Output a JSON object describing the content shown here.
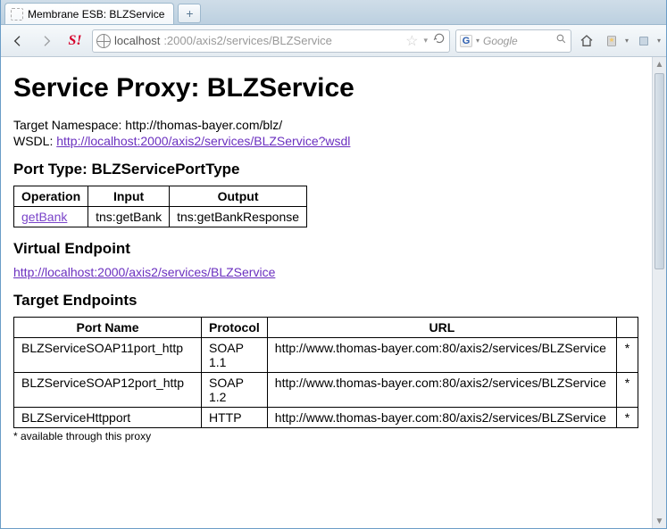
{
  "browser": {
    "tab_title": "Membrane ESB: BLZService",
    "newtab_glyph": "+",
    "url_host": "localhost",
    "url_rest": ":2000/axis2/services/BLZService",
    "search_placeholder": "Google"
  },
  "page": {
    "heading": "Service Proxy: BLZService",
    "ns_label": "Target Namespace: ",
    "ns_value": "http://thomas-bayer.com/blz/",
    "wsdl_label": "WSDL: ",
    "wsdl_link": "http://localhost:2000/axis2/services/BLZService?wsdl",
    "porttype_heading": "Port Type: BLZServicePortType",
    "ops_headers": {
      "op": "Operation",
      "in": "Input",
      "out": "Output"
    },
    "ops": [
      {
        "name": "getBank",
        "input": "tns:getBank",
        "output": "tns:getBankResponse"
      }
    ],
    "virtual_heading": "Virtual Endpoint",
    "virtual_link": "http://localhost:2000/axis2/services/BLZService",
    "targets_heading": "Target Endpoints",
    "tgt_headers": {
      "port": "Port Name",
      "proto": "Protocol",
      "url": "URL"
    },
    "targets": [
      {
        "port": "BLZServiceSOAP11port_http",
        "proto": "SOAP 1.1",
        "url": "http://www.thomas-bayer.com:80/axis2/services/BLZService",
        "mark": "*"
      },
      {
        "port": "BLZServiceSOAP12port_http",
        "proto": "SOAP 1.2",
        "url": "http://www.thomas-bayer.com:80/axis2/services/BLZService",
        "mark": "*"
      },
      {
        "port": "BLZServiceHttpport",
        "proto": "HTTP",
        "url": "http://www.thomas-bayer.com:80/axis2/services/BLZService",
        "mark": "*"
      }
    ],
    "footnote": "* available through this proxy"
  }
}
